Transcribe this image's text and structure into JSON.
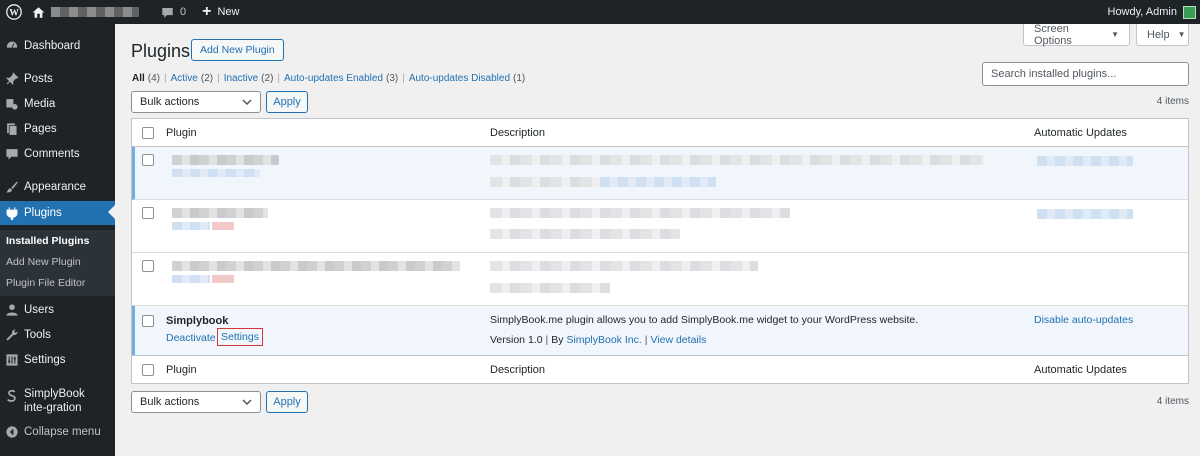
{
  "admin_bar": {
    "comments_count": "0",
    "new_label": "New",
    "howdy": "Howdy, Admin"
  },
  "sidebar": {
    "items": [
      {
        "label": "Dashboard",
        "icon": "dashboard-icon"
      },
      {
        "label": "Posts",
        "icon": "pin-icon"
      },
      {
        "label": "Media",
        "icon": "media-icon"
      },
      {
        "label": "Pages",
        "icon": "pages-icon"
      },
      {
        "label": "Comments",
        "icon": "comments-icon"
      },
      {
        "label": "Appearance",
        "icon": "brush-icon"
      },
      {
        "label": "Plugins",
        "icon": "plugin-icon"
      },
      {
        "label": "Users",
        "icon": "users-icon"
      },
      {
        "label": "Tools",
        "icon": "wrench-icon"
      },
      {
        "label": "Settings",
        "icon": "settings-icon"
      },
      {
        "label": "SimplyBook inte-gration",
        "icon": "simplybook-icon"
      },
      {
        "label": "Collapse menu",
        "icon": "collapse-icon"
      }
    ],
    "submenu": [
      "Installed Plugins",
      "Add New Plugin",
      "Plugin File Editor"
    ]
  },
  "header": {
    "title": "Plugins",
    "add_new": "Add New Plugin",
    "screen_options": "Screen Options",
    "help": "Help"
  },
  "filters": [
    {
      "label": "All",
      "count": "(4)"
    },
    {
      "label": "Active",
      "count": "(2)"
    },
    {
      "label": "Inactive",
      "count": "(2)"
    },
    {
      "label": "Auto-updates Enabled",
      "count": "(3)"
    },
    {
      "label": "Auto-updates Disabled",
      "count": "(1)"
    }
  ],
  "search": {
    "placeholder": "Search installed plugins..."
  },
  "bulk": {
    "select_label": "Bulk actions",
    "apply": "Apply",
    "items_count": "4 items"
  },
  "table": {
    "columns": [
      "Plugin",
      "Description",
      "Automatic Updates"
    ],
    "simplybook": {
      "name": "Simplybook",
      "deactivate": "Deactivate",
      "settings": "Settings",
      "description": "SimplyBook.me plugin allows you to add SimplyBook.me widget to your WordPress website.",
      "version": "Version 1.0",
      "by": "By",
      "author": "SimplyBook Inc.",
      "view_details": "View details",
      "auto_update": "Disable auto-updates"
    }
  },
  "colors": {
    "accent": "#2271b1",
    "sidebar": "#1d2327",
    "highlight": "#d63638"
  }
}
